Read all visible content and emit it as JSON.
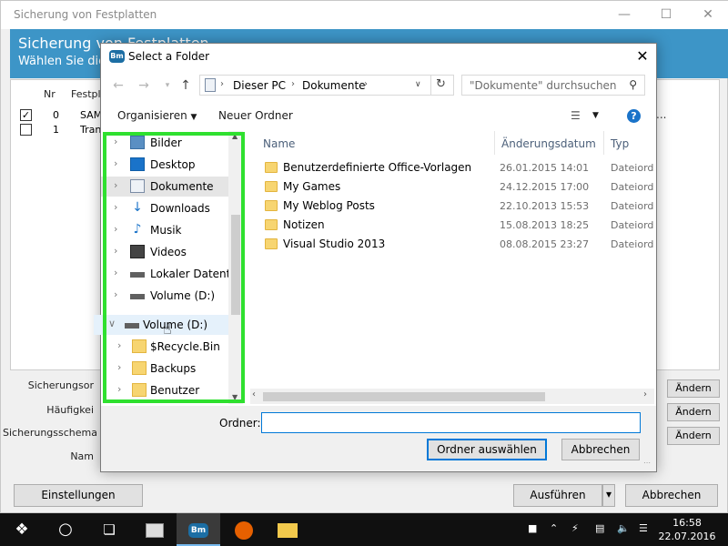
{
  "app": {
    "title": "Sicherung von Festplatten",
    "header_title": "Sicherung von Festplatten",
    "header_subtitle": "Wählen Sie die",
    "columns": [
      "Nr",
      "Festpl"
    ],
    "disks": [
      {
        "checked": true,
        "nr": "0",
        "name": "SAMS"
      },
      {
        "checked": false,
        "nr": "1",
        "name": "Trans"
      }
    ],
    "fields": [
      "Sicherungsor",
      "Häufigkei",
      "Sicherungsschema",
      "Nam"
    ],
    "change_buttons": [
      "Ändern",
      "Ändern",
      "Ändern"
    ],
    "settings_button": "Einstellungen",
    "run_button": "Ausführen",
    "cancel_button": "Abbrechen"
  },
  "dialog": {
    "title": "Select a Folder",
    "logo_text": "Bm",
    "breadcrumb": [
      "Dieser PC",
      "Dokumente"
    ],
    "search_placeholder": "\"Dokumente\" durchsuchen",
    "toolbar": {
      "organize": "Organisieren",
      "new_folder": "Neuer Ordner",
      "more": "..."
    },
    "nav_items": [
      {
        "label": "Bilder",
        "icon": "pictures-icon",
        "expanded": false,
        "selected": false
      },
      {
        "label": "Desktop",
        "icon": "desktop-icon",
        "expanded": false,
        "selected": false
      },
      {
        "label": "Dokumente",
        "icon": "documents-icon",
        "expanded": false,
        "selected": true
      },
      {
        "label": "Downloads",
        "icon": "downloads-icon",
        "expanded": false,
        "selected": false
      },
      {
        "label": "Musik",
        "icon": "music-icon",
        "expanded": false,
        "selected": false
      },
      {
        "label": "Videos",
        "icon": "videos-icon",
        "expanded": false,
        "selected": false
      },
      {
        "label": "Lokaler Datenträger (C:)",
        "icon": "local-disk-icon",
        "expanded": false,
        "selected": false
      },
      {
        "label": "Volume (D:)",
        "icon": "drive-icon",
        "expanded": false,
        "selected": false
      },
      {
        "label": "Volume (D:)",
        "icon": "drive-icon",
        "expanded": true,
        "selected": false
      },
      {
        "label": "$Recycle.Bin",
        "icon": "folder-icon",
        "expanded": false,
        "selected": false
      },
      {
        "label": "Backups",
        "icon": "folder-icon",
        "expanded": false,
        "selected": false
      },
      {
        "label": "Benutzer",
        "icon": "folder-icon",
        "expanded": false,
        "selected": false
      }
    ],
    "columns": {
      "name": "Name",
      "date": "Änderungsdatum",
      "type": "Typ"
    },
    "files": [
      {
        "name": "Benutzerdefinierte Office-Vorlagen",
        "date": "26.01.2015 14:01",
        "type": "Dateiordner"
      },
      {
        "name": "My Games",
        "date": "24.12.2015 17:00",
        "type": "Dateiordner"
      },
      {
        "name": "My Weblog Posts",
        "date": "22.10.2013 15:53",
        "type": "Dateiordner"
      },
      {
        "name": "Notizen",
        "date": "15.08.2013 18:25",
        "type": "Dateiordner"
      },
      {
        "name": "Visual Studio 2013",
        "date": "08.08.2015 23:27",
        "type": "Dateiordner"
      }
    ],
    "folder_label": "Ordner:",
    "folder_value": "",
    "select_button": "Ordner auswählen",
    "cancel_button": "Abbrechen"
  },
  "taskbar": {
    "time": "16:58",
    "date": "22.07.2016",
    "pinned": [
      "start-icon",
      "cortana-icon",
      "task-view-icon",
      "app-icon",
      "backup-app-icon",
      "firefox-icon",
      "explorer-icon"
    ]
  },
  "colors": {
    "header_blue": "#3d95c7",
    "highlight_green": "#2fe02f",
    "accent": "#0078d7"
  }
}
